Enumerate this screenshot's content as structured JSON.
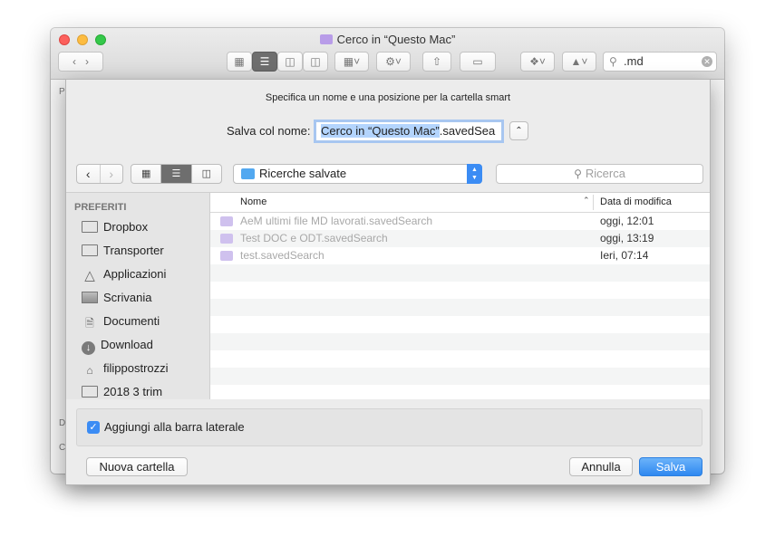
{
  "finder": {
    "title": "Cerco in “Questo Mac”",
    "search_value": ".md",
    "side_letters": [
      "P",
      "D",
      "C"
    ]
  },
  "sheet": {
    "message": "Specifica un nome e una posizione per la cartella smart",
    "save_as_label": "Salva col nome:",
    "save_as_selected": "Cerco in “Questo Mac”",
    "save_as_rest": ".savedSea",
    "location": "Ricerche salvate",
    "search_placeholder": "Ricerca",
    "sidebar": {
      "header": "PREFERITI",
      "items": [
        {
          "label": "Dropbox",
          "icon": "folder-icon"
        },
        {
          "label": "Transporter",
          "icon": "folder-icon"
        },
        {
          "label": "Applicazioni",
          "icon": "applications-icon"
        },
        {
          "label": "Scrivania",
          "icon": "desktop-icon"
        },
        {
          "label": "Documenti",
          "icon": "documents-icon"
        },
        {
          "label": "Download",
          "icon": "download-icon"
        },
        {
          "label": "filippostrozzi",
          "icon": "home-icon"
        },
        {
          "label": "2018 3 trim",
          "icon": "folder-icon"
        }
      ]
    },
    "columns": {
      "name": "Nome",
      "date": "Data di modifica"
    },
    "files": [
      {
        "name": "AeM ultimi file MD lavorati.savedSearch",
        "date": "oggi, 12:01"
      },
      {
        "name": "Test DOC e ODT.savedSearch",
        "date": "oggi, 13:19"
      },
      {
        "name": "test.savedSearch",
        "date": "Ieri, 07:14"
      }
    ],
    "checkbox_label": "Aggiungi alla barra laterale",
    "checkbox_checked": true,
    "new_folder_label": "Nuova cartella",
    "cancel_label": "Annulla",
    "save_label": "Salva"
  },
  "colors": {
    "accent": "#3b8cf4",
    "selection": "#b3d4fd"
  }
}
